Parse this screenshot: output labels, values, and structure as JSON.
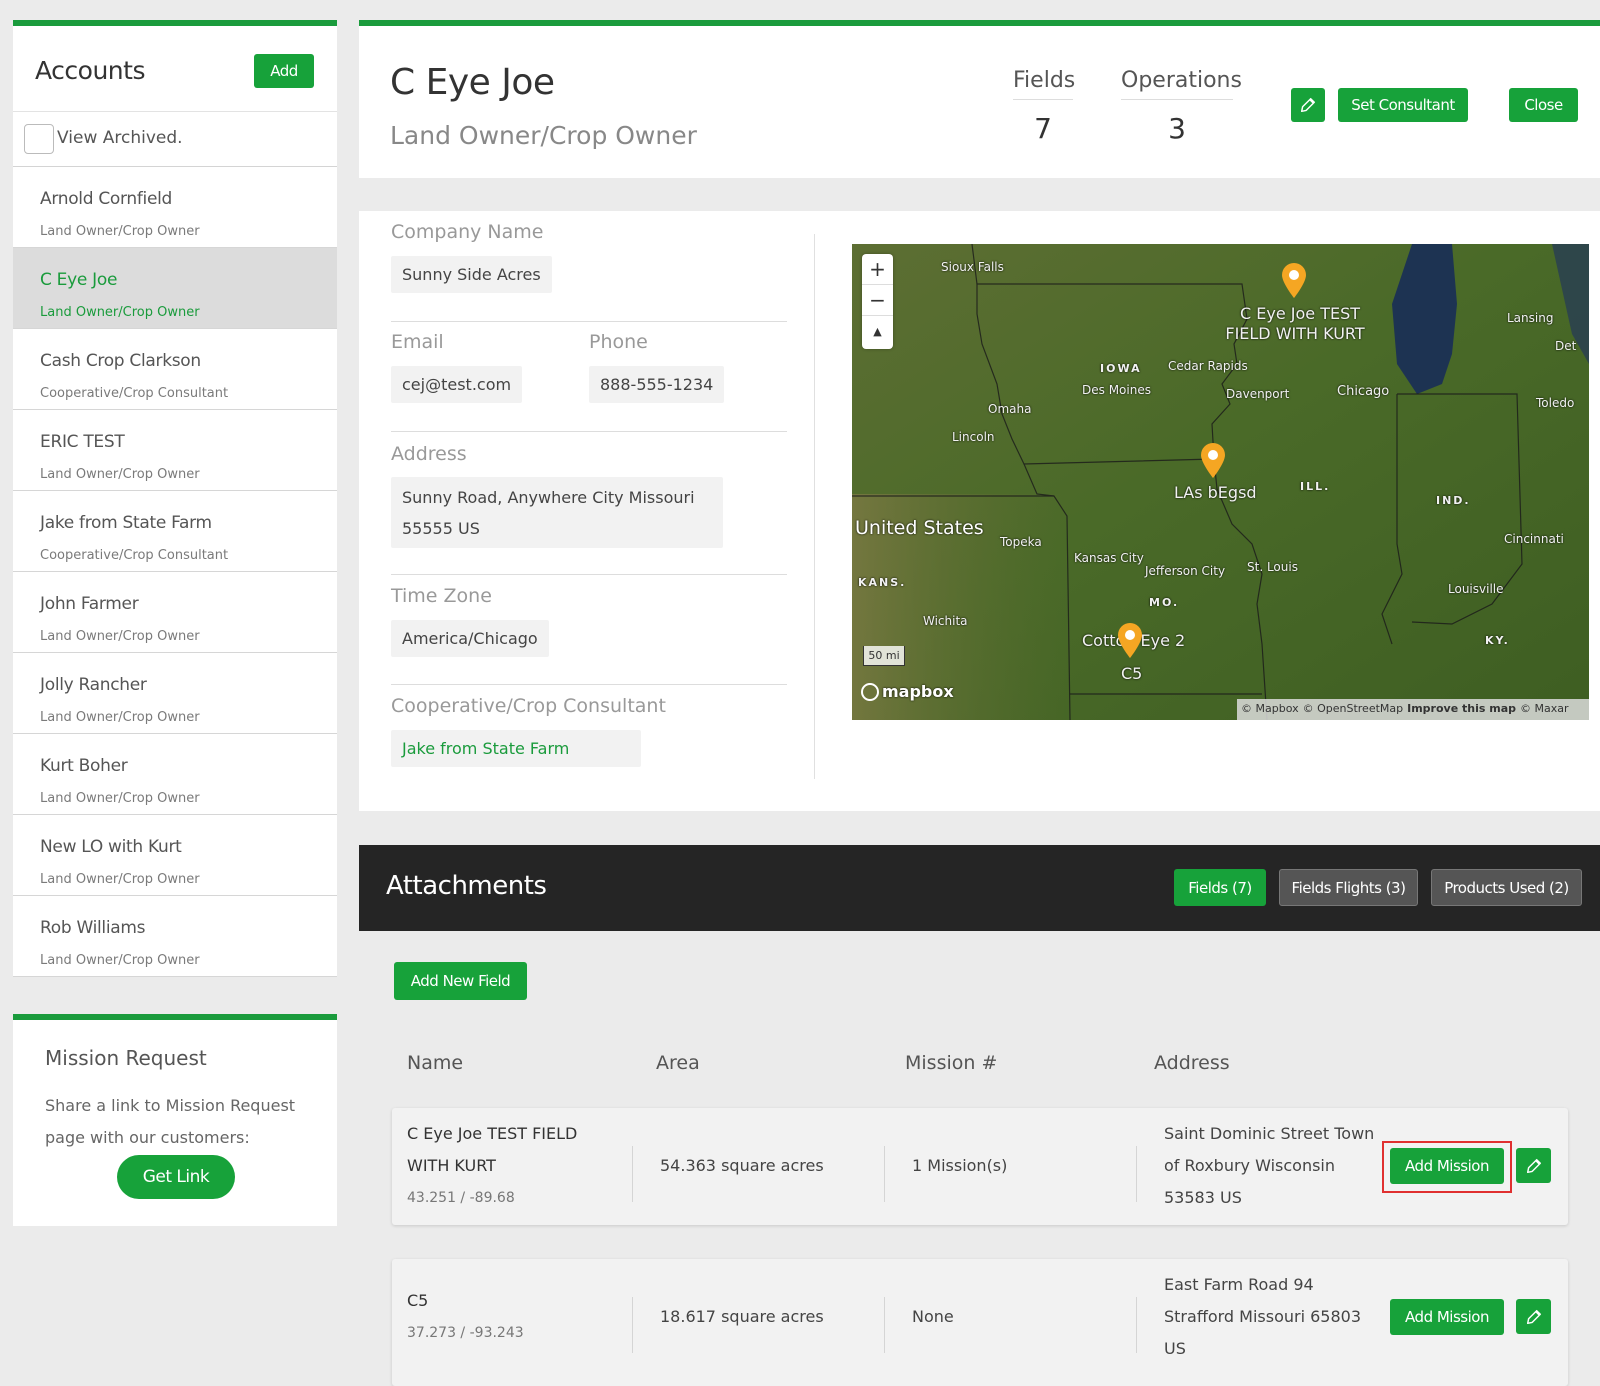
{
  "sidebar": {
    "title": "Accounts",
    "add_label": "Add",
    "view_archived": "View Archived.",
    "accounts": [
      {
        "name": "Arnold Cornfield",
        "role": "Land Owner/Crop Owner"
      },
      {
        "name": "C Eye Joe",
        "role": "Land Owner/Crop Owner"
      },
      {
        "name": "Cash Crop Clarkson",
        "role": "Cooperative/Crop Consultant"
      },
      {
        "name": "ERIC TEST",
        "role": "Land Owner/Crop Owner"
      },
      {
        "name": "Jake from State Farm",
        "role": "Cooperative/Crop Consultant"
      },
      {
        "name": "John Farmer",
        "role": "Land Owner/Crop Owner"
      },
      {
        "name": "Jolly Rancher",
        "role": "Land Owner/Crop Owner"
      },
      {
        "name": "Kurt Boher",
        "role": "Land Owner/Crop Owner"
      },
      {
        "name": "New LO with Kurt",
        "role": "Land Owner/Crop Owner"
      },
      {
        "name": "Rob Williams",
        "role": "Land Owner/Crop Owner"
      }
    ],
    "selected_index": 1
  },
  "mission_request": {
    "title": "Mission Request",
    "text": "Share a link to Mission Request page with our customers:",
    "button": "Get Link"
  },
  "header": {
    "name": "C Eye Joe",
    "role": "Land Owner/Crop Owner",
    "fields_label": "Fields",
    "fields_value": "7",
    "operations_label": "Operations",
    "operations_value": "3",
    "set_consultant": "Set Consultant",
    "close": "Close"
  },
  "details": {
    "company_label": "Company Name",
    "company_value": "Sunny Side Acres",
    "email_label": "Email",
    "email_value": "cej@test.com",
    "phone_label": "Phone",
    "phone_value": "888-555-1234",
    "address_label": "Address",
    "address_line1": "Sunny Road, Anywhere City Missouri",
    "address_line2": "55555 US",
    "timezone_label": "Time Zone",
    "timezone_value": "America/Chicago",
    "consultant_label": "Cooperative/Crop Consultant",
    "consultant_value": "Jake from State Farm"
  },
  "map": {
    "zoom_in": "+",
    "zoom_out": "−",
    "compass": "▲",
    "scale": "50 mi",
    "logo": "mapbox",
    "attribution_1": "© Mapbox",
    "attribution_2": "© OpenStreetMap",
    "attribution_3": "Improve this map",
    "attribution_4": "© Maxar",
    "labels": {
      "sioux_falls": "Sioux Falls",
      "lansing": "Lansing",
      "det": "Det",
      "iowa": "IOWA",
      "cedar_rapids": "Cedar Rapids",
      "des_moines": "Des Moines",
      "davenport": "Davenport",
      "chicago": "Chicago",
      "toledo": "Toledo",
      "omaha": "Omaha",
      "lincoln": "Lincoln",
      "ill": "ILL.",
      "ind": "IND.",
      "united_states": "United States",
      "topeka": "Topeka",
      "kansas_city": "Kansas City",
      "jefferson_city": "Jefferson City",
      "st_louis": "St. Louis",
      "cincinnati": "Cincinnati",
      "kans": "KANS.",
      "mo": "MO.",
      "louisville": "Louisville",
      "wichita": "Wichita",
      "ky": "KY."
    },
    "markers": {
      "m1_line1": "C Eye Joe TEST",
      "m1_line2": "FIELD WITH KURT",
      "m2": "LAs bEgsd",
      "m3": "Cotton Eye 2",
      "m4": "C5"
    },
    "colors": {
      "marker": "#f5a623",
      "land": "#4d6b2a",
      "water": "#1c2f4a"
    }
  },
  "attachments": {
    "title": "Attachments",
    "tabs": [
      "Fields (7)",
      "Fields Flights (3)",
      "Products Used (2)"
    ],
    "add_field": "Add New Field",
    "columns": [
      "Name",
      "Area",
      "Mission #",
      "Address"
    ],
    "rows": [
      {
        "name_line1": "C Eye Joe TEST FIELD",
        "name_line2": "WITH KURT",
        "coords": "43.251 / -89.68",
        "area": "54.363 square acres",
        "missions": "1 Mission(s)",
        "addr_line1": "Saint Dominic Street Town",
        "addr_line2": "of Roxbury Wisconsin",
        "addr_line3": "53583 US",
        "add_mission": "Add Mission"
      },
      {
        "name_line1": "C5",
        "coords": "37.273 / -93.243",
        "area": "18.617 square acres",
        "missions": "None",
        "addr_line1": "East Farm Road 94",
        "addr_line2": "Strafford Missouri 65803",
        "addr_line3": "US",
        "add_mission": "Add Mission"
      }
    ]
  },
  "colors": {
    "accent": "#17a23a",
    "highlight": "#e03030",
    "dark_header": "#252525"
  }
}
